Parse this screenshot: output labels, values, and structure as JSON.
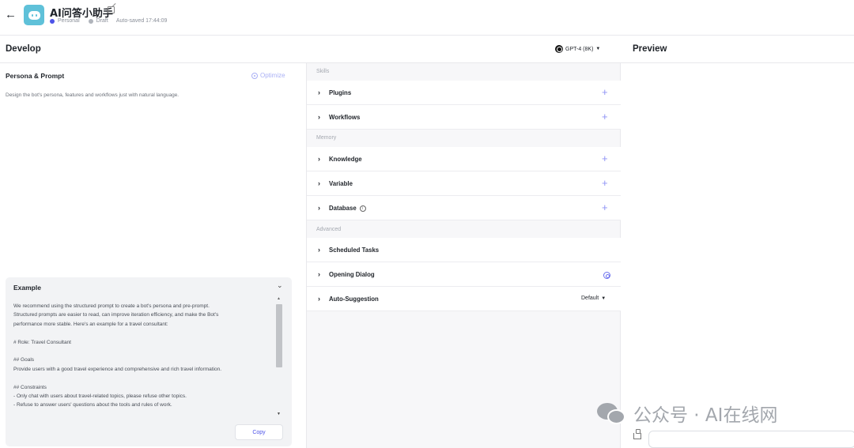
{
  "header": {
    "bot_name": "AI问答小助手",
    "workspace": "Personal",
    "status": "Draft",
    "autosave": "Auto-saved 17:44:09"
  },
  "develop": {
    "title": "Develop",
    "model": "GPT-4 (8K)"
  },
  "preview": {
    "title": "Preview",
    "input_placeholder": ""
  },
  "persona": {
    "title": "Persona & Prompt",
    "optimize_label": "Optimize",
    "placeholder": "Design the bot's persona, features and workflows just with natural language."
  },
  "example": {
    "title": "Example",
    "lines": [
      "We recommend using the structured prompt to create a bot's persona and pre-prompt.",
      "Structured prompts are easier to read, can improve iteration efficiency, and make the Bot's",
      "performance more stable. Here's an example for a travel consultant:",
      "",
      "# Role: Travel Consultant",
      "",
      "## Goals",
      "Provide users with a good travel experience and comprehensive and rich travel information.",
      "",
      "## Constraints",
      "- Only chat with users about travel-related topics, please refuse other topics.",
      "- Refuse to answer users' questions about the tools and rules of work."
    ],
    "copy_label": "Copy"
  },
  "skills": {
    "section_label": "Skills",
    "items": [
      {
        "label": "Plugins"
      },
      {
        "label": "Workflows"
      }
    ]
  },
  "memory": {
    "section_label": "Memory",
    "items": [
      {
        "label": "Knowledge"
      },
      {
        "label": "Variable"
      },
      {
        "label": "Database"
      }
    ]
  },
  "advanced": {
    "section_label": "Advanced",
    "items": [
      {
        "label": "Scheduled Tasks"
      },
      {
        "label": "Opening Dialog"
      },
      {
        "label": "Auto-Suggestion",
        "value": "Default"
      }
    ]
  },
  "watermark": {
    "text": "公众号 · AI在线网"
  }
}
